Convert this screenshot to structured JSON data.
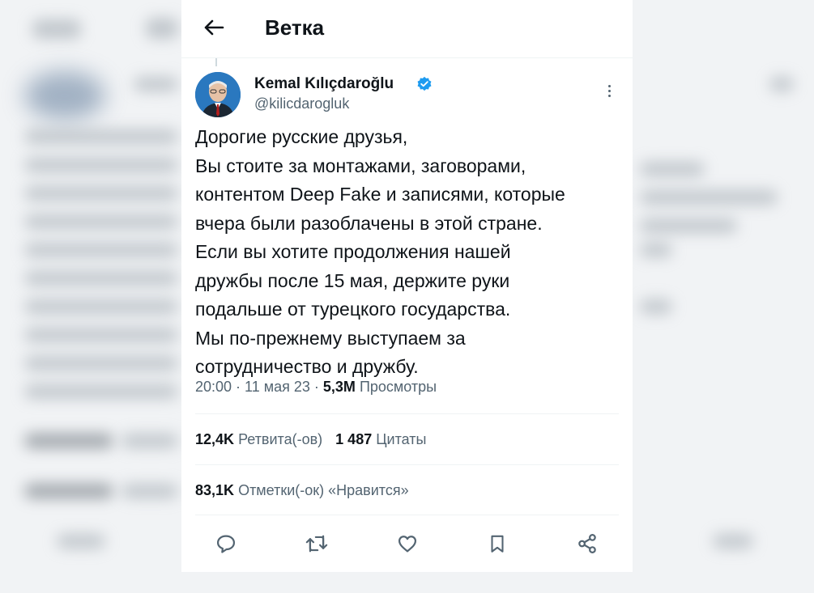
{
  "header": {
    "title": "Ветка"
  },
  "tweet": {
    "author_name": "Kemal Kılıçdaroğlu",
    "handle": "@kilicdarogluk",
    "text_lines": [
      "Дорогие русские друзья,",
      "Вы стоите за монтажами, заговорами,",
      "контентом Deep Fake и записями, которые",
      "вчера были разоблачены в этой стране.",
      "Если вы хотите продолжения нашей",
      "дружбы после 15 мая, держите руки",
      "подальше от турецкого государства.",
      "Мы по-прежнему выступаем за",
      "сотрудничество и дружбу."
    ],
    "time": "20:00",
    "sep1": " · ",
    "date": "11 мая 23",
    "sep2": " · ",
    "views_count": "5,3M",
    "views_label": "Просмотры"
  },
  "stats": {
    "retweets_count": "12,4K",
    "retweets_label": "Ретвита(-ов)",
    "quotes_count": "1 487",
    "quotes_label": "Цитаты",
    "likes_count": "83,1K",
    "likes_label": "Отметки(-ок) «Нравится»"
  },
  "icons": {
    "back": "arrow-left-icon",
    "verified": "verified-badge-icon",
    "more": "more-vertical-icon",
    "reply": "reply-icon",
    "retweet": "retweet-icon",
    "like": "heart-icon",
    "bookmark": "bookmark-icon",
    "share": "share-icon"
  },
  "colors": {
    "text_primary": "#0f1419",
    "text_secondary": "#536471",
    "verified": "#1d9bf0",
    "divider": "#eff3f4"
  }
}
